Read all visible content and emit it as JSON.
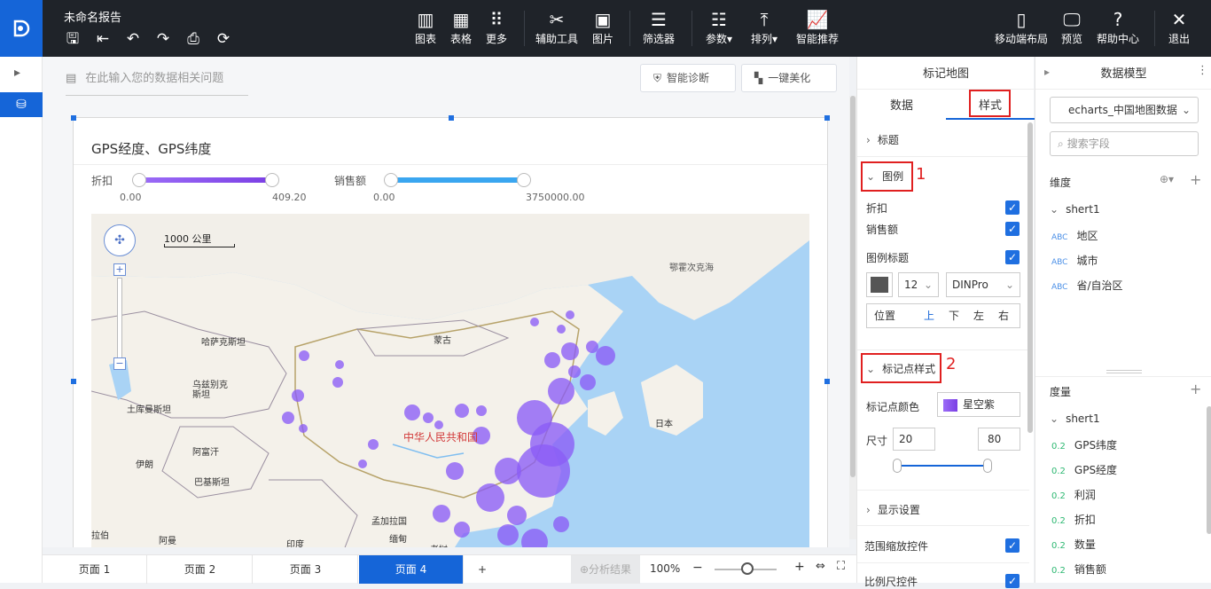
{
  "app": {
    "title": "未命名报告"
  },
  "toolbar": {
    "chart": "图表",
    "table": "表格",
    "more": "更多",
    "assist": "辅助工具",
    "image": "图片",
    "filter": "筛选器",
    "param": "参数",
    "arrange": "排列",
    "smart": "智能推荐",
    "mobile": "移动端布局",
    "preview": "预览",
    "help": "帮助中心",
    "exit": "退出"
  },
  "canvas": {
    "question_placeholder": "在此输入您的数据相关问题",
    "diagnose": "智能诊断",
    "beautify": "一键美化"
  },
  "chart": {
    "title": "GPS经度、GPS纬度",
    "slider1": {
      "label": "折扣",
      "min": "0.00",
      "max": "409.20"
    },
    "slider2": {
      "label": "销售额",
      "min": "0.00",
      "max": "3750000.00"
    },
    "scale": "1000 公里",
    "colors": {
      "accent": "#8b5cf6",
      "sea": "#a9d3f5"
    }
  },
  "map_labels": {
    "okhotsk": "鄂霍次克海",
    "kazakh": "哈萨克斯坦",
    "mongolia": "蒙古",
    "uzbek": "乌兹别克\n斯坦",
    "turkmen": "土库曼斯坦",
    "china": "中华人民共和国",
    "japan": "日本",
    "iran": "伊朗",
    "afghan": "阿富汗",
    "pakistan": "巴基斯坦",
    "bangla": "孟加拉国",
    "india": "印度",
    "myanmar": "缅甸",
    "laos": "老挝",
    "oman": "阿曼",
    "bo": "拉伯"
  },
  "right_panel": {
    "header": "标记地图",
    "tab_data": "数据",
    "tab_style": "样式",
    "section_title": "标题",
    "section_legend": "图例",
    "legend_discount": "折扣",
    "legend_sales": "销售额",
    "legend_title": "图例标题",
    "font_size": "12",
    "font_name": "DINPro",
    "position_label": "位置",
    "pos_up": "上",
    "pos_down": "下",
    "pos_left": "左",
    "pos_right": "右",
    "section_marker": "标记点样式",
    "marker_color_label": "标记点颜色",
    "marker_color_value": "星空紫",
    "size_label": "尺寸",
    "size_min": "20",
    "size_max": "80",
    "display_settings": "显示设置",
    "zoom_control": "范围缩放控件",
    "scale_control": "比例尺控件",
    "annot1": "1",
    "annot2": "2"
  },
  "data_model": {
    "header": "数据模型",
    "dataset": "echarts_中国地图数据",
    "search_placeholder": "搜索字段",
    "dimension_label": "维度",
    "dim_sheet": "shert1",
    "dimensions": [
      "地区",
      "城市",
      "省/自治区"
    ],
    "measure_label": "度量",
    "mea_sheet": "shert1",
    "measures": [
      "GPS纬度",
      "GPS经度",
      "利润",
      "折扣",
      "数量",
      "销售额"
    ],
    "type_abc": "ABC",
    "type_num": "0.2"
  },
  "pages": {
    "tabs": [
      "页面 1",
      "页面 2",
      "页面 3",
      "页面 4"
    ],
    "add": "+",
    "analysis": "分析结果",
    "zoom": "100%"
  }
}
